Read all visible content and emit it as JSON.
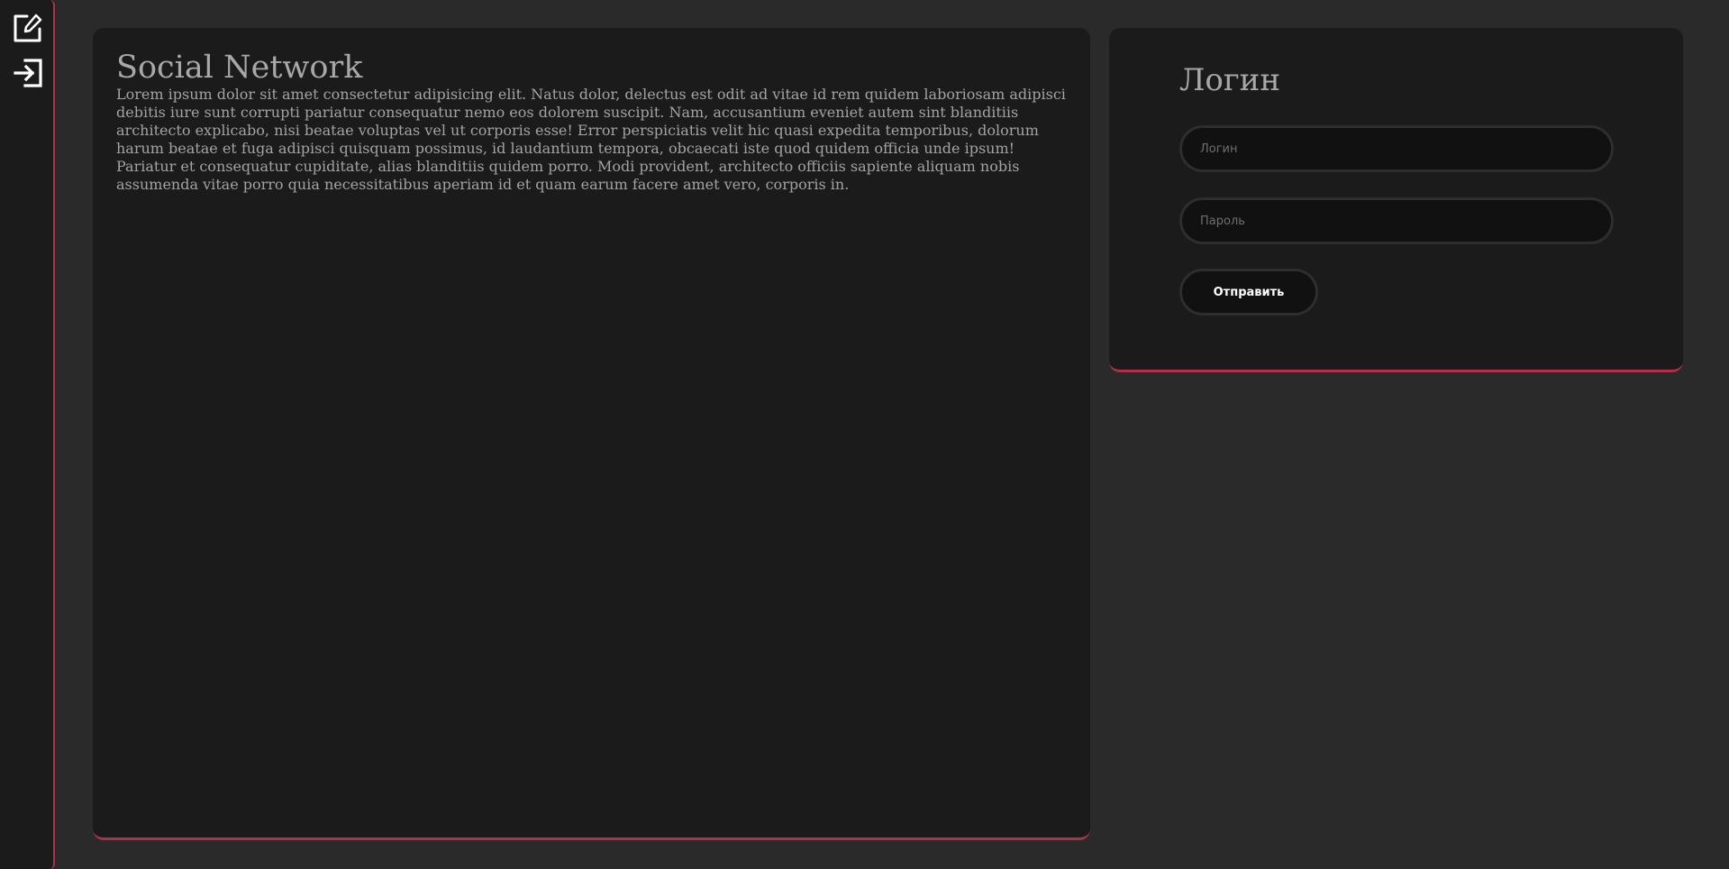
{
  "sidebar": {
    "icons": [
      "edit-icon",
      "login-icon"
    ]
  },
  "main": {
    "title": "Social Network",
    "text": "Lorem ipsum dolor sit amet consectetur adipisicing elit. Natus dolor, delectus est odit ad vitae id rem quidem laboriosam adipisci debitis iure sunt corrupti pariatur consequatur nemo eos dolorem suscipit. Nam, accusantium eveniet autem sint blanditiis architecto explicabo, nisi beatae voluptas vel ut corporis esse! Error perspiciatis velit hic quasi expedita temporibus, dolorum harum beatae et fuga adipisci quisquam possimus, id laudantium tempora, obcaecati iste quod quidem officia unde ipsum! Pariatur et consequatur cupiditate, alias blanditiis quidem porro. Modi provident, architecto officiis sapiente aliquam nobis assumenda vitae porro quia necessitatibus aperiam id et quam earum facere amet vero, corporis in."
  },
  "login": {
    "title": "Логин",
    "login_placeholder": "Логин",
    "login_value": "",
    "password_placeholder": "Пароль",
    "password_value": "",
    "submit_label": "Отправить"
  },
  "colors": {
    "background": "#2a2a2a",
    "card": "#1b1b1b",
    "accent": "#b03049",
    "input": "#111111"
  }
}
